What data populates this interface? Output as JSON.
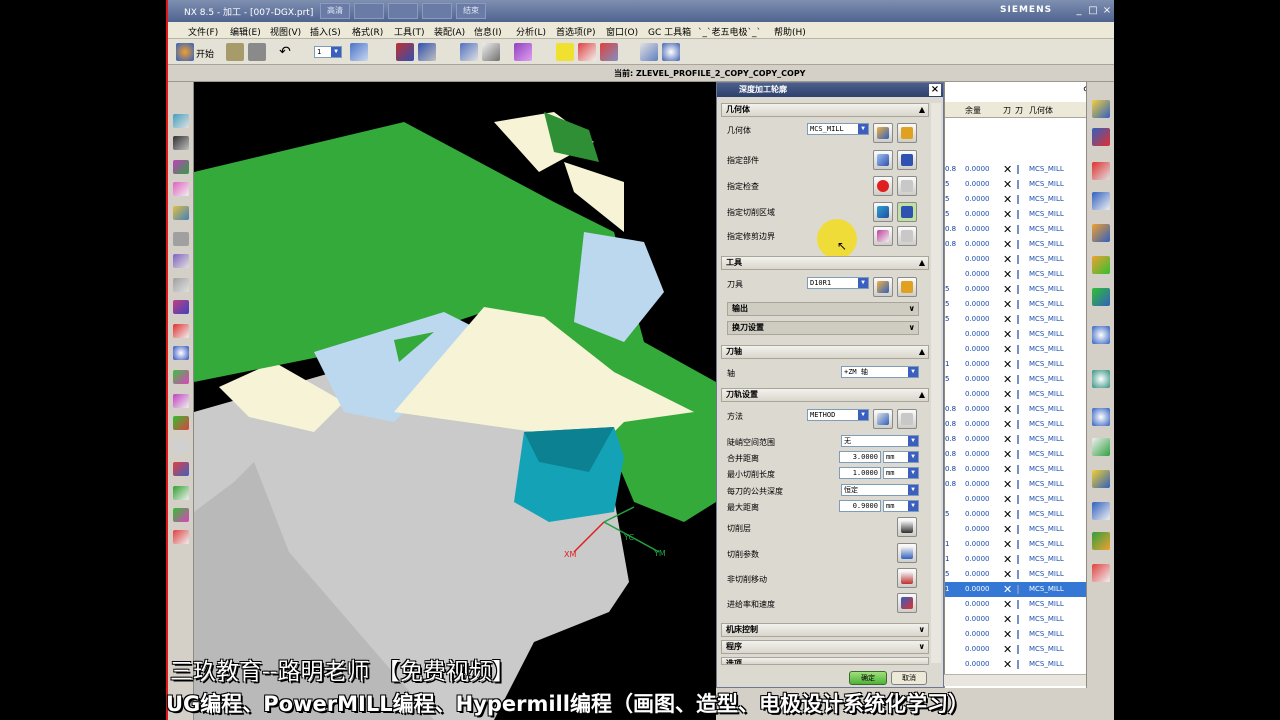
{
  "window": {
    "title": "NX 8.5 - 加工 - [007-DGX.prt]",
    "title_buttons": [
      "高清",
      "",
      "",
      "",
      "结束"
    ],
    "brand": "SIEMENS",
    "controls": [
      "_",
      "□",
      "×"
    ]
  },
  "menu": [
    "文件(F)",
    "编辑(E)",
    "视图(V)",
    "插入(S)",
    "格式(R)",
    "工具(T)",
    "装配(A)",
    "信息(I)",
    "分析(L)",
    "首选项(P)",
    "窗口(O)",
    "GC 工具箱",
    "`_`老五电极`_`",
    "帮助(H)"
  ],
  "toolbar": {
    "start_label": "开始",
    "layer_value": "1"
  },
  "status": {
    "current_op": "当前: ZLEVEL_PROFILE_2_COPY_COPY_COPY"
  },
  "dialog": {
    "title": "深度加工轮廓",
    "sections": {
      "geometry": "几何体",
      "tool": "工具",
      "output": "输出",
      "tool_change": "换刀设置",
      "tool_axis": "刀轴",
      "path_settings": "刀轨设置",
      "machine_control": "机床控制",
      "program": "程序",
      "options": "选项"
    },
    "geometry_label": "几何体",
    "geometry_value": "MCS_MILL",
    "specify_part": "指定部件",
    "specify_check": "指定检查",
    "specify_cut_area": "指定切削区域",
    "specify_trim": "指定修剪边界",
    "tool_label": "刀具",
    "tool_value": "D10R1",
    "axis_label": "轴",
    "axis_value": "+ZM 轴",
    "method_label": "方法",
    "method_value": "METHOD",
    "steep_label": "陡峭空间范围",
    "steep_value": "无",
    "merge_label": "合并距离",
    "merge_value": "3.0000",
    "merge_unit": "mm",
    "min_cut_label": "最小切削长度",
    "min_cut_value": "1.0000",
    "min_cut_unit": "mm",
    "common_depth_label": "每刀的公共深度",
    "common_depth_value": "恒定",
    "max_dist_label": "最大距离",
    "max_dist_value": "0.9000",
    "max_dist_unit": "mm",
    "cut_levels": "切削层",
    "cut_params": "切削参数",
    "non_cut_moves": "非切削移动",
    "feeds_speeds": "进给率和速度",
    "ok": "确定",
    "cancel": "取消"
  },
  "navigator": {
    "headers": [
      "余量",
      "刀",
      "刀",
      "几何体"
    ],
    "rows": [
      {
        "a": "0.8",
        "b": "0.0000",
        "g": "MCS_MILL"
      },
      {
        "a": "5",
        "b": "0.0000",
        "g": "MCS_MILL"
      },
      {
        "a": "5",
        "b": "0.0000",
        "g": "MCS_MILL"
      },
      {
        "a": "5",
        "b": "0.0000",
        "g": "MCS_MILL"
      },
      {
        "a": "0.8",
        "b": "0.0000",
        "g": "MCS_MILL"
      },
      {
        "a": "0.8",
        "b": "0.0000",
        "g": "MCS_MILL"
      },
      {
        "a": "",
        "b": "0.0000",
        "g": "MCS_MILL"
      },
      {
        "a": "",
        "b": "0.0000",
        "g": "MCS_MILL"
      },
      {
        "a": "5",
        "b": "0.0000",
        "g": "MCS_MILL"
      },
      {
        "a": "5",
        "b": "0.0000",
        "g": "MCS_MILL"
      },
      {
        "a": "5",
        "b": "0.0000",
        "g": "MCS_MILL"
      },
      {
        "a": "",
        "b": "0.0000",
        "g": "MCS_MILL"
      },
      {
        "a": "",
        "b": "0.0000",
        "g": "MCS_MILL"
      },
      {
        "a": "1",
        "b": "0.0000",
        "g": "MCS_MILL"
      },
      {
        "a": "5",
        "b": "0.0000",
        "g": "MCS_MILL"
      },
      {
        "a": "",
        "b": "0.0000",
        "g": "MCS_MILL"
      },
      {
        "a": "0.8",
        "b": "0.0000",
        "g": "MCS_MILL"
      },
      {
        "a": "0.8",
        "b": "0.0000",
        "g": "MCS_MILL"
      },
      {
        "a": "0.8",
        "b": "0.0000",
        "g": "MCS_MILL"
      },
      {
        "a": "0.8",
        "b": "0.0000",
        "g": "MCS_MILL"
      },
      {
        "a": "0.8",
        "b": "0.0000",
        "g": "MCS_MILL"
      },
      {
        "a": "0.8",
        "b": "0.0000",
        "g": "MCS_MILL"
      },
      {
        "a": "",
        "b": "0.0000",
        "g": "MCS_MILL"
      },
      {
        "a": "5",
        "b": "0.0000",
        "g": "MCS_MILL"
      },
      {
        "a": "",
        "b": "0.0000",
        "g": "MCS_MILL"
      },
      {
        "a": "1",
        "b": "0.0000",
        "g": "MCS_MILL"
      },
      {
        "a": "1",
        "b": "0.0000",
        "g": "MCS_MILL"
      },
      {
        "a": "5",
        "b": "0.0000",
        "g": "MCS_MILL"
      },
      {
        "a": "1",
        "b": "0.0000",
        "g": "MCS_MILL",
        "selected": true
      },
      {
        "a": "",
        "b": "0.0000",
        "g": "MCS_MILL"
      },
      {
        "a": "",
        "b": "0.0000",
        "g": "MCS_MILL"
      },
      {
        "a": "",
        "b": "0.0000",
        "g": "MCS_MILL"
      },
      {
        "a": "",
        "b": "0.0000",
        "g": "MCS_MILL"
      },
      {
        "a": "",
        "b": "0.0000",
        "g": "MCS_MILL"
      }
    ]
  },
  "viewport": {
    "axis_labels": [
      "XM",
      "YC",
      "YM"
    ]
  },
  "caption": {
    "line1": "三玖教育--路明老师  【免费视频】",
    "line2": "UG编程、PowerMILL编程、Hypermill编程（画图、造型、电极设计系统化学习）"
  },
  "colors": {
    "model_green": "#33aa3a",
    "model_cream": "#f6f3d6",
    "model_gray": "#c9cac9",
    "pocket_teal": "#14a3b6",
    "selected_row": "#3477d5",
    "highlight_yellow": "#f2dc28"
  }
}
